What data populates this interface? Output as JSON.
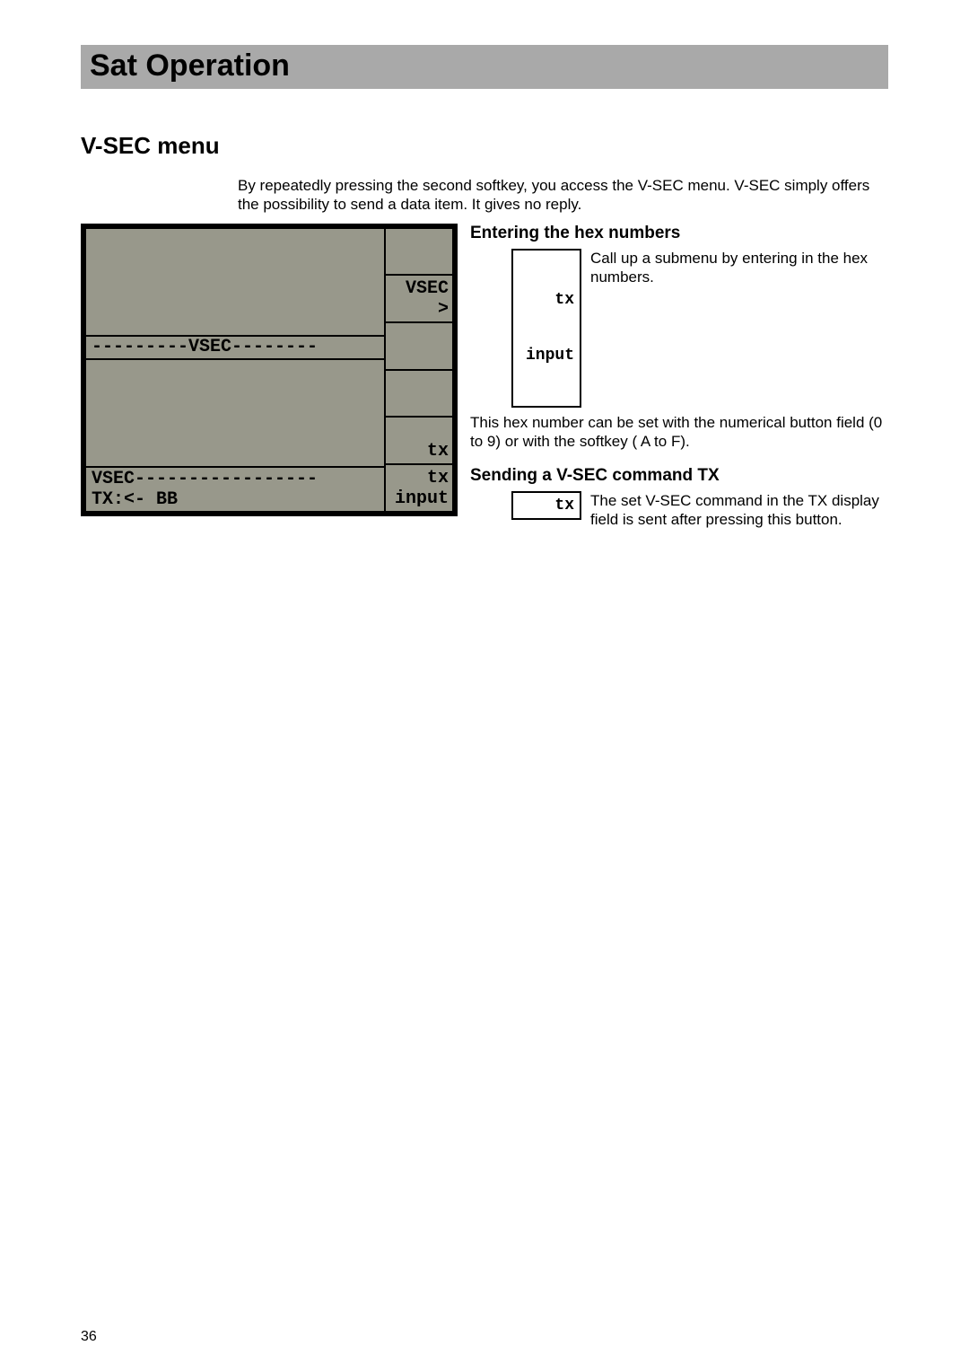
{
  "header": {
    "title": "Sat Operation"
  },
  "section": {
    "title": "V-SEC menu"
  },
  "intro": "By repeatedly pressing the second softkey, you access the V-SEC menu. V-SEC simply offers the possibility to send a data item. It gives no reply.",
  "lcd": {
    "top": "",
    "middle": "---------VSEC--------",
    "gap": "",
    "bottom_line1": "VSEC-----------------",
    "bottom_line2": "TX:<- BB"
  },
  "softkeys": {
    "k1": "",
    "k2_line1": "VSEC",
    "k2_line2": ">",
    "k3": "",
    "k4": "",
    "k5": "tx",
    "k6_line1": "tx",
    "k6_line2": "input"
  },
  "right": {
    "hex_heading": "Entering the hex numbers",
    "hex_box_line1": "tx",
    "hex_box_line2": "input",
    "hex_call_text": "Call up a submenu by entering in the hex numbers.",
    "hex_after": "This hex number can be set with the numerical button field (0 to 9) or with the softkey ( A to F).",
    "tx_heading": "Sending a V-SEC command TX",
    "tx_box": "tx",
    "tx_call_text": "The set V-SEC command in the TX display field is sent after pressing this button."
  },
  "page_number": "36"
}
